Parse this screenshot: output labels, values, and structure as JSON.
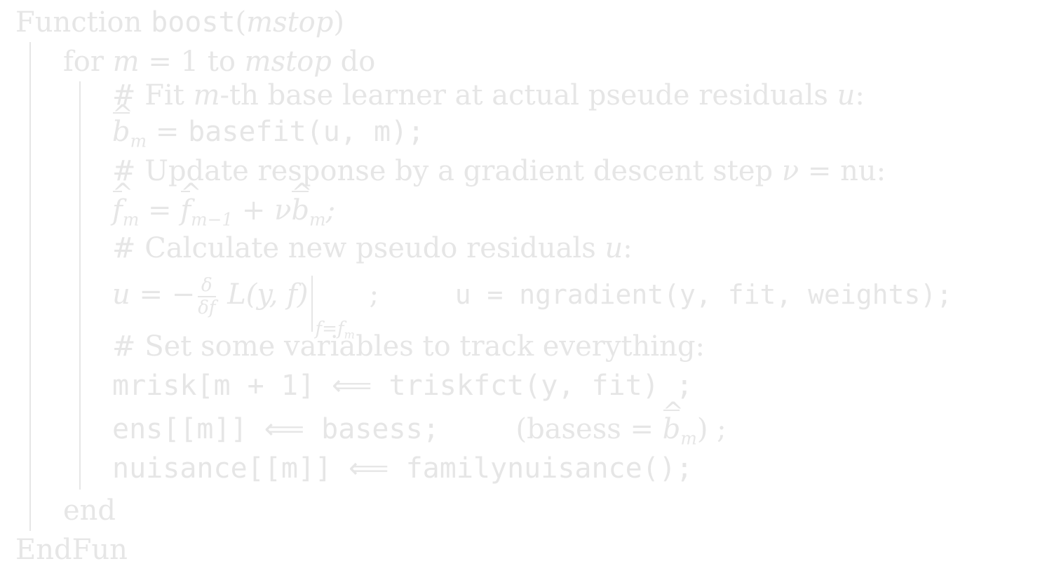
{
  "algorithm": {
    "header_keyword": "Function",
    "header_name": "boost",
    "header_param": "mstop",
    "for_keyword": "for",
    "for_var": "m",
    "for_eq": "= 1",
    "for_to": "to",
    "for_limit": "mstop",
    "for_do": "do",
    "comment_fit": "# Fit",
    "comment_fit_var": "m",
    "comment_fit_rest": "-th base learner at actual pseude residuals",
    "comment_fit_u": "u",
    "comment_fit_colon": ":",
    "bhat_base": "b",
    "bhat_sub": "m",
    "bhat_assign": "=",
    "bhat_code": "basefit(u, m);",
    "comment_update": "# Update response by a gradient descent step",
    "comment_update_nu": "ν",
    "comment_update_eq": "= nu:",
    "fhat_base": "f",
    "fhat_sub": "m",
    "fhat_eq": "=",
    "fhat_prev_base": "f",
    "fhat_prev_sub": "m−1",
    "fhat_plus": "+ ν",
    "fhat_b_base": "b",
    "fhat_b_sub": "m",
    "fhat_semicolon": ";",
    "comment_calc": "# Calculate new pseudo residuals",
    "comment_calc_u": "u",
    "comment_calc_colon": ":",
    "u_lhs": "u",
    "u_eq": "= −",
    "frac_num": "δ",
    "frac_den": "δf",
    "loss": "L(y, f)",
    "eval_sub": "f=f",
    "eval_sub_index": "m",
    "u_semicolon": ";",
    "u_code": "u = ngradient(y, fit, weights);",
    "comment_track": "# Set some variables to track everything:",
    "mrisk_code": "mrisk[m + 1] ⟸ triskfct(y, fit) ;",
    "ens_code": "ens[[m]] ⟸ basess;",
    "ens_note_open": "(basess =",
    "ens_note_b": "b",
    "ens_note_sub": "m",
    "ens_note_close": ") ;",
    "nuisance_code": "nuisance[[m]] ⟸ familynuisance();",
    "end_keyword": "end",
    "endfun_keyword": "EndFun"
  }
}
